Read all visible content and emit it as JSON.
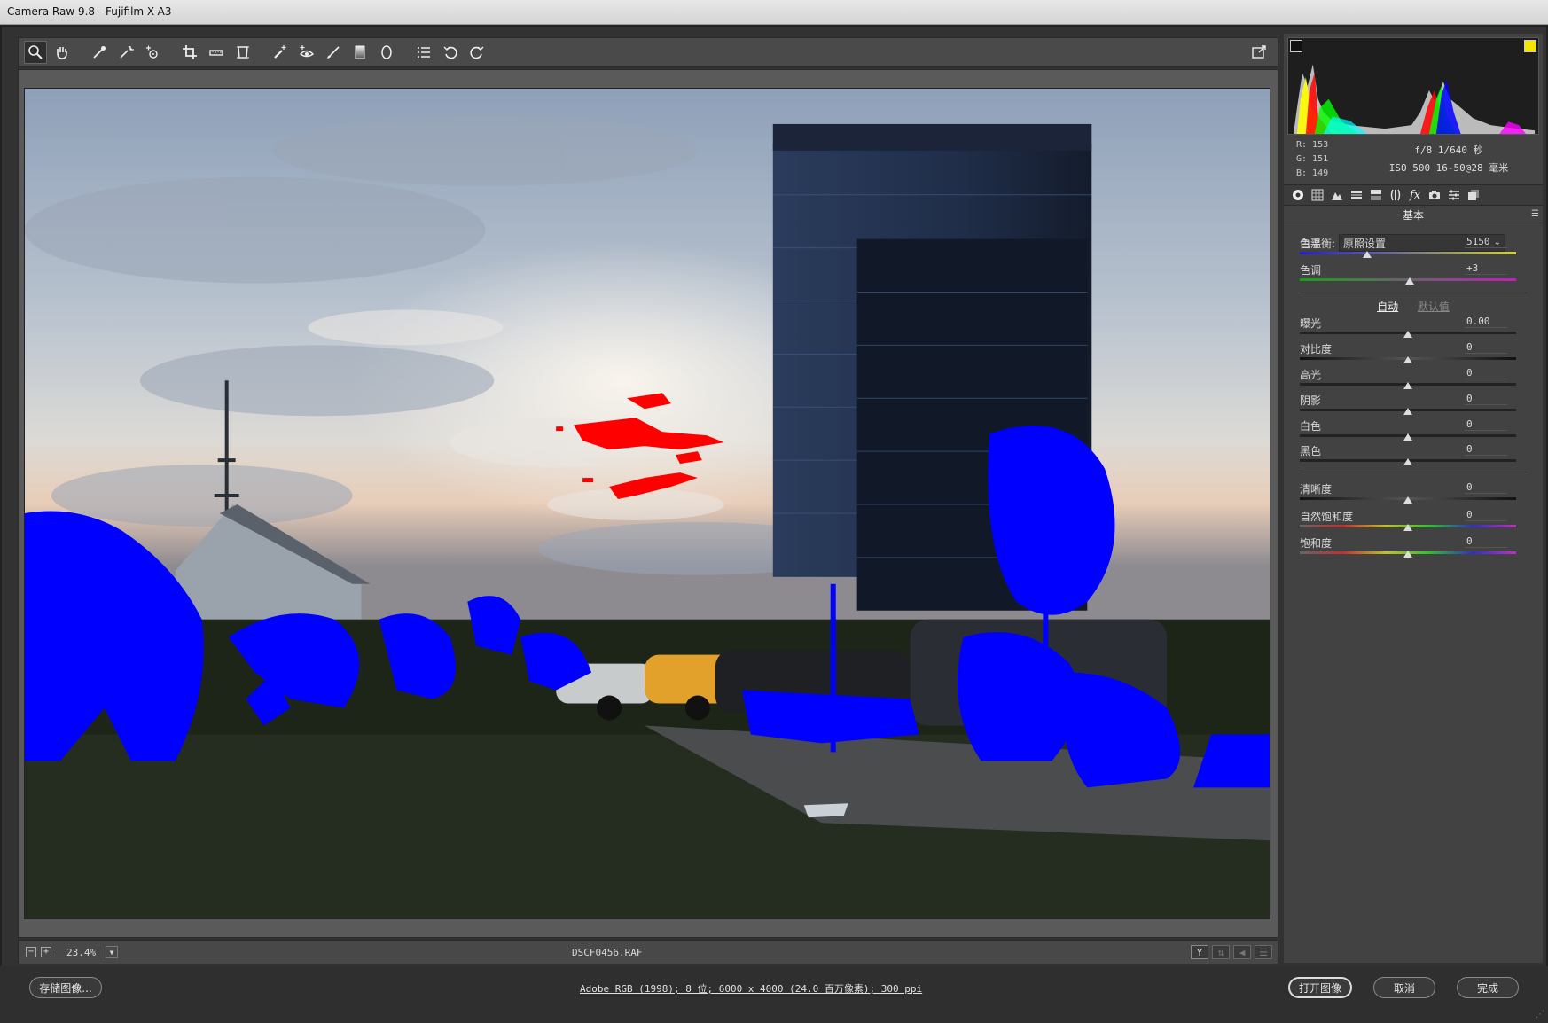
{
  "window": {
    "title": "Camera Raw 9.8 -  Fujifilm X-A3"
  },
  "colors": {
    "panel": "#424242",
    "accent": "#f2e600",
    "shadow_clip": "#0000ff",
    "highlight_clip": "#ff0000"
  },
  "toolbar": {
    "tools": [
      "zoom-icon",
      "hand-icon",
      "white-balance-icon",
      "color-sampler-icon",
      "targeted-adjust-icon",
      "crop-icon",
      "straighten-icon",
      "transform-icon",
      "spot-removal-icon",
      "red-eye-icon",
      "adjustment-brush-icon",
      "graduated-filter-icon",
      "radial-filter-icon",
      "preferences-icon",
      "rotate-left-icon",
      "rotate-right-icon"
    ]
  },
  "preview_bar": {
    "zoom_out": "−",
    "zoom_in": "+",
    "zoom": "23.4%",
    "filename": "DSCF0456.RAF",
    "view_y": "Y"
  },
  "readout": {
    "r": "R:  153",
    "g": "G:  151",
    "b": "B:  149"
  },
  "exif": {
    "line1": "f/8  1/640 秒",
    "line2": "ISO 500  16-50@28 毫米"
  },
  "panel": {
    "heading": "基本",
    "wb_label": "白平衡:",
    "wb_value": "原照设置",
    "auto": "自动",
    "default": "默认值",
    "sliders": {
      "temp": {
        "label": "色温",
        "value": "5150",
        "pos": 0.31
      },
      "tint": {
        "label": "色调",
        "value": "+3",
        "pos": 0.51
      },
      "exposure": {
        "label": "曝光",
        "value": "0.00",
        "pos": 0.5
      },
      "contrast": {
        "label": "对比度",
        "value": "0",
        "pos": 0.5
      },
      "highlights": {
        "label": "高光",
        "value": "0",
        "pos": 0.5
      },
      "shadows": {
        "label": "阴影",
        "value": "0",
        "pos": 0.5
      },
      "whites": {
        "label": "白色",
        "value": "0",
        "pos": 0.5
      },
      "blacks": {
        "label": "黑色",
        "value": "0",
        "pos": 0.5
      },
      "clarity": {
        "label": "清晰度",
        "value": "0",
        "pos": 0.5
      },
      "vibrance": {
        "label": "自然饱和度",
        "value": "0",
        "pos": 0.5
      },
      "saturation": {
        "label": "饱和度",
        "value": "0",
        "pos": 0.5
      }
    }
  },
  "footer": {
    "save": "存储图像...",
    "workflow": "Adobe RGB (1998); 8 位; 6000 x 4000 (24.0 百万像素); 300 ppi",
    "open": "打开图像",
    "cancel": "取消",
    "done": "完成"
  }
}
